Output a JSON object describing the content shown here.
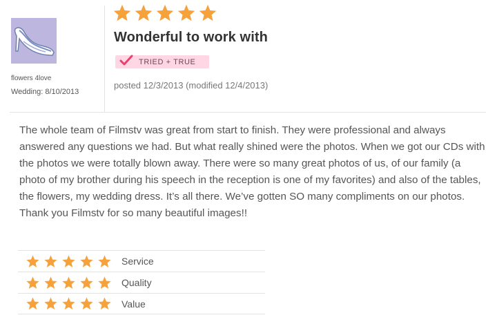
{
  "reviewer": {
    "name": "flowers 4love",
    "wedding": "Wedding: 8/10/2013"
  },
  "review": {
    "overall_rating": 5,
    "title": "Wonderful to work with",
    "badge_label": "TRIED + TRUE",
    "posted": "posted 12/3/2013 (modified 12/4/2013)",
    "body": "The whole team of Filmstv was great from start to finish. They were professional and always answered any questions we had. But what really shined were the photos. When we got our CDs with the photos we were totally blown away. There were so many great photos of us, of our family (a photo of my brother during his speech in the reception is one of my favorites) and also of the tables, the flowers, my wedding dress. It’s all there. We’ve gotten SO many compliments on our photos. Thank you Filmstv for so many beautiful images!!"
  },
  "ratings": [
    {
      "label": "Service",
      "stars": 5
    },
    {
      "label": "Quality",
      "stars": 5
    },
    {
      "label": "Value",
      "stars": 5
    }
  ],
  "colors": {
    "star": "#f7a13b",
    "badge_bg": "#ffd6e3",
    "badge_check": "#e8416e",
    "avatar_bg": "#bdb6de"
  }
}
